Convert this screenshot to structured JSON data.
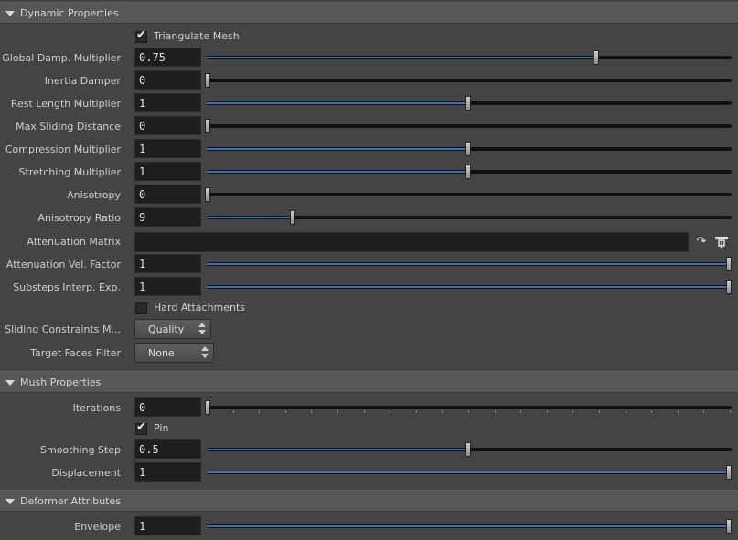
{
  "sections": {
    "dynamic": "Dynamic Properties",
    "mush": "Mush Properties",
    "deformer": "Deformer Attributes"
  },
  "triangulate_mesh": {
    "label": "Triangulate Mesh",
    "checked": true
  },
  "global_damp": {
    "label": "Global Damp. Multiplier",
    "value": "0.75",
    "slider": 0.745
  },
  "inertia_damper": {
    "label": "Inertia Damper",
    "value": "0",
    "slider": 0.0
  },
  "rest_length": {
    "label": "Rest Length Multiplier",
    "value": "1",
    "slider": 0.5
  },
  "max_sliding": {
    "label": "Max Sliding Distance",
    "value": "0",
    "slider": 0.0
  },
  "compression": {
    "label": "Compression Multiplier",
    "value": "1",
    "slider": 0.5
  },
  "stretching": {
    "label": "Stretching Multiplier",
    "value": "1",
    "slider": 0.5
  },
  "anisotropy": {
    "label": "Anisotropy",
    "value": "0",
    "slider": 0.0
  },
  "anisotropy_ratio": {
    "label": "Anisotropy Ratio",
    "value": "9",
    "slider": 0.163
  },
  "attenuation_matrix": {
    "label": "Attenuation Matrix",
    "value": ""
  },
  "attenuation_vel": {
    "label": "Attenuation Vel. Factor",
    "value": "1",
    "slider": 1.0
  },
  "substeps": {
    "label": "Substeps Interp. Exp.",
    "value": "1",
    "slider": 1.0
  },
  "hard_attachments": {
    "label": "Hard Attachments",
    "checked": false
  },
  "sliding_constraints": {
    "label": "Sliding Constraints M...",
    "value": "Quality"
  },
  "target_faces": {
    "label": "Target Faces Filter",
    "value": "None"
  },
  "iterations": {
    "label": "Iterations",
    "value": "0",
    "slider": 0.0
  },
  "pin": {
    "label": "Pin",
    "checked": true
  },
  "smoothing_step": {
    "label": "Smoothing Step",
    "value": "0.5",
    "slider": 0.5
  },
  "displacement": {
    "label": "Displacement",
    "value": "1",
    "slider": 1.0
  },
  "envelope": {
    "label": "Envelope",
    "value": "1",
    "slider": 1.0
  },
  "icons": {
    "arrow": "redo-arrow-icon",
    "connect": "connect-node-icon"
  },
  "colors": {
    "accent": "#3f6fb5",
    "background": "#444444",
    "header": "#575757",
    "field": "#1e1e1e"
  }
}
